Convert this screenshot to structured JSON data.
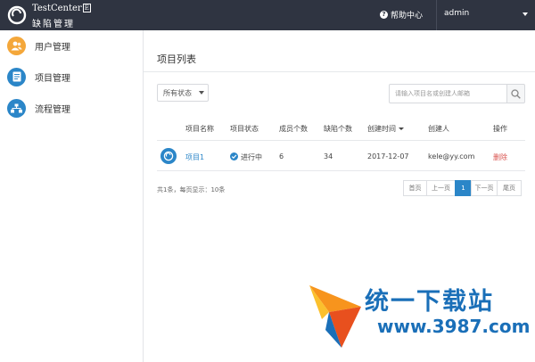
{
  "header": {
    "app_name": "TestCenter",
    "app_badge": "E",
    "app_subtitle": "缺陷管理",
    "help_label": "帮助中心",
    "user_name": "admin",
    "colors": {
      "bar": "#2f3441",
      "accent": "#2b86c8"
    }
  },
  "sidebar": {
    "items": [
      {
        "label": "用户管理",
        "icon": "users-icon",
        "color": "#f4a73a"
      },
      {
        "label": "项目管理",
        "icon": "document-icon",
        "color": "#2b86c8"
      },
      {
        "label": "流程管理",
        "icon": "flow-icon",
        "color": "#2b86c8"
      }
    ]
  },
  "main": {
    "title": "项目列表",
    "filter": {
      "selected": "所有状态"
    },
    "search": {
      "placeholder": "请输入项目名或创建人邮箱",
      "value": ""
    },
    "table": {
      "columns": [
        "项目名称",
        "项目状态",
        "成员个数",
        "缺陷个数",
        "创建时间",
        "创建人",
        "操作"
      ],
      "rows": [
        {
          "icon": "project-logo-icon",
          "name": "项目1",
          "status": "进行中",
          "members": "6",
          "defects": "34",
          "created_at": "2017-12-07",
          "creator": "kele@yy.com",
          "action": "删除"
        }
      ]
    },
    "total_text": "共1条，每页显示：10条",
    "pagination": {
      "first": "首页",
      "prev": "上一页",
      "current": "1",
      "next": "下一页",
      "last": "尾页"
    }
  },
  "watermark": {
    "text": "统一下载站",
    "url": "www.3987.com"
  }
}
